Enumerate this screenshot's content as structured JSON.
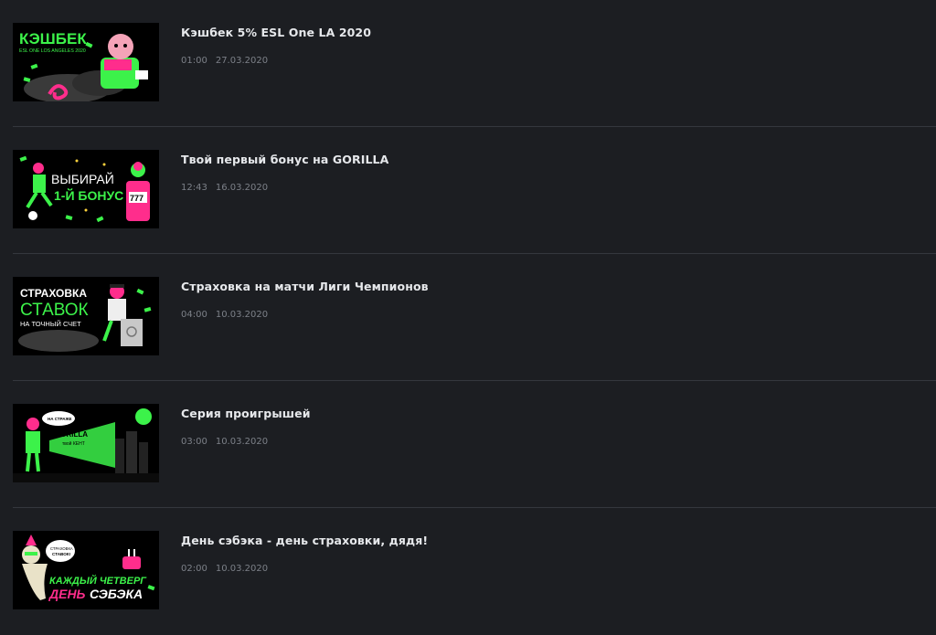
{
  "colors": {
    "background": "#1c1e22",
    "divider": "#34373d",
    "title": "#e6e8eb",
    "meta": "#7c8088",
    "accent_green": "#3cf24a",
    "accent_pink": "#ff2d8c"
  },
  "news": [
    {
      "title": "Кэшбек 5% ESL One LA 2020",
      "time": "01:00",
      "date": "27.03.2020",
      "banner": {
        "line1": "КЭШБЕК",
        "line2": "ESL ONE LOS ANGELES 2020"
      }
    },
    {
      "title": "Твой первый бонус на GORILLA",
      "time": "12:43",
      "date": "16.03.2020",
      "banner": {
        "line1": "ВЫБИРАЙ",
        "line2": "1-Й БОНУС",
        "slot": "777"
      }
    },
    {
      "title": "Страховка на матчи Лиги Чемпионов",
      "time": "04:00",
      "date": "10.03.2020",
      "banner": {
        "line1": "СТРАХОВКА",
        "line2": "СТАВОК",
        "line3": "НА ТОЧНЫЙ СЧЕТ"
      }
    },
    {
      "title": "Серия проигрышей",
      "time": "03:00",
      "date": "10.03.2020",
      "banner": {
        "bubble": "НА СТРАЖЕ",
        "line1": "GORILLA",
        "line2": "твой КЕНТ"
      }
    },
    {
      "title": "День сэбэка - день страховки, дядя!",
      "time": "02:00",
      "date": "10.03.2020",
      "banner": {
        "bubble1": "СТРАХОВКА",
        "bubble2": "СТАВОК!",
        "line1": "КАЖДЫЙ ЧЕТВЕРГ",
        "line2a": "ДЕНЬ",
        "line2b": "СЭБЭКА"
      }
    }
  ]
}
